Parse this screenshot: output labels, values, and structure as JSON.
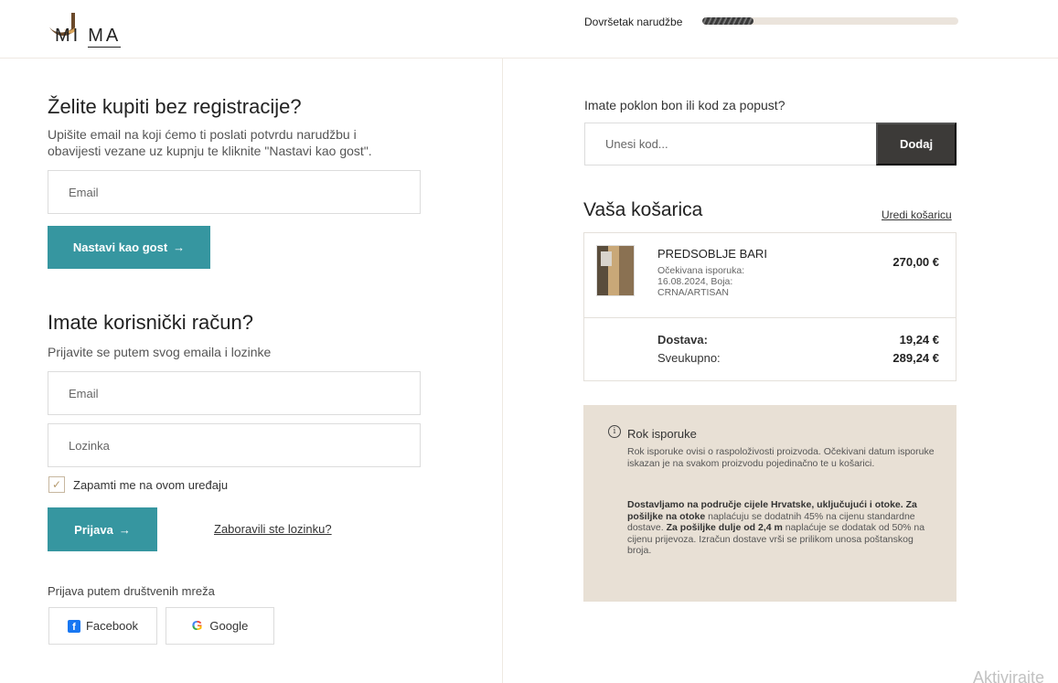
{
  "header": {
    "logo_letters_1": "MI",
    "logo_letters_2": "MA",
    "progress_label": "Dovršetak narudžbe",
    "progress_fraction": 0.2
  },
  "guest": {
    "title": "Želite kupiti bez registracije?",
    "description": "Upišite email na koji ćemo ti poslati potvrdu narudžbu i obavijesti vezane uz kupnju te kliknite \"Nastavi kao gost\".",
    "email_placeholder": "Email",
    "continue_label": "Nastavi kao gost"
  },
  "login": {
    "title": "Imate korisnički račun?",
    "description": "Prijavite se putem svog emaila i lozinke",
    "email_placeholder": "Email",
    "password_placeholder": "Lozinka",
    "remember_label": "Zapamti me na ovom uređaju",
    "submit_label": "Prijava",
    "forgot_label": "Zaboravili ste lozinku?",
    "social_title": "Prijava putem društvenih mreža",
    "facebook_label": "Facebook",
    "google_label": "Google"
  },
  "voucher": {
    "title": "Imate poklon bon ili kod za popust?",
    "placeholder": "Unesi kod...",
    "add_label": "Dodaj"
  },
  "cart": {
    "title": "Vaša košarica",
    "edit_label": "Uredi košaricu",
    "item": {
      "name": "PREDSOBLJE BARI",
      "meta": "Očekivana isporuka: 16.08.2024, Boja: CRNA/ARTISAN",
      "price": "270,00 €"
    },
    "shipping_label": "Dostava:",
    "shipping_value": "19,24 €",
    "total_label": "Sveukupno:",
    "total_value": "289,24 €"
  },
  "info": {
    "title": "Rok isporuke",
    "text1": "Rok isporuke ovisi o raspoloživosti proizvoda. Očekivani datum isporuke iskazan je na svakom proizvodu pojedinačno te u košarici.",
    "bold1": "Dostavljamo na područje cijele Hrvatske, uključujući i otoke. Za pošiljke na otoke",
    "text2": " naplaćuju se dodatnih 45% na cijenu standardne dostave. ",
    "bold2": "Za pošiljke dulje od 2,4 m",
    "text3": " naplaćuje se dodatak od 50% na cijenu prijevoza. Izračun dostave vrši se prilikom unosa poštanskog broja."
  },
  "watermark": "Aktivirajte"
}
